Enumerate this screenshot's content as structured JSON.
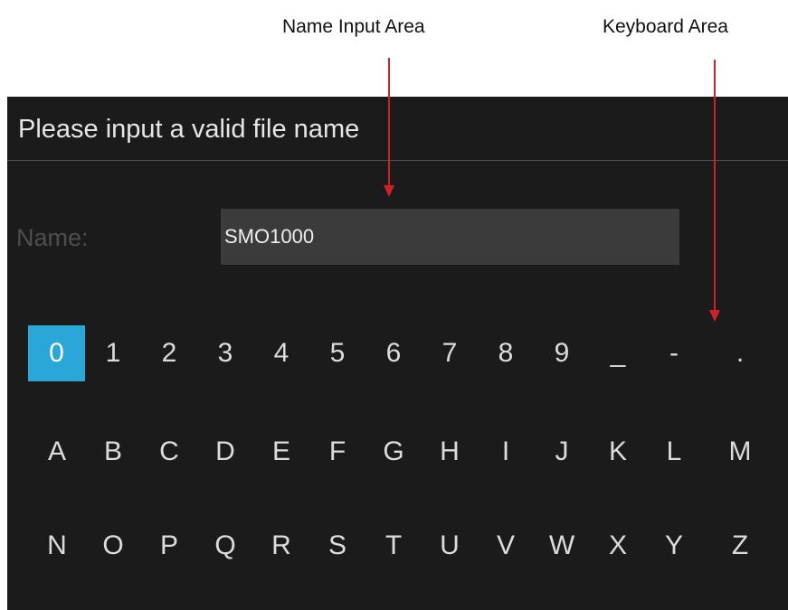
{
  "callouts": {
    "name_input_area": "Name Input Area",
    "keyboard_area": "Keyboard Area",
    "arrow_color": "#d0202a"
  },
  "dialog": {
    "title": "Please input a valid file name",
    "name_label": "Name:",
    "name_value": "SMO1000"
  },
  "keyboard": {
    "selected_key": "0",
    "selected_color": "#2aa6d8",
    "rows": [
      [
        "0",
        "1",
        "2",
        "3",
        "4",
        "5",
        "6",
        "7",
        "8",
        "9",
        "_",
        "-",
        "."
      ],
      [
        "A",
        "B",
        "C",
        "D",
        "E",
        "F",
        "G",
        "H",
        "I",
        "J",
        "K",
        "L",
        "M"
      ],
      [
        "N",
        "O",
        "P",
        "Q",
        "R",
        "S",
        "T",
        "U",
        "V",
        "W",
        "X",
        "Y",
        "Z"
      ]
    ]
  }
}
